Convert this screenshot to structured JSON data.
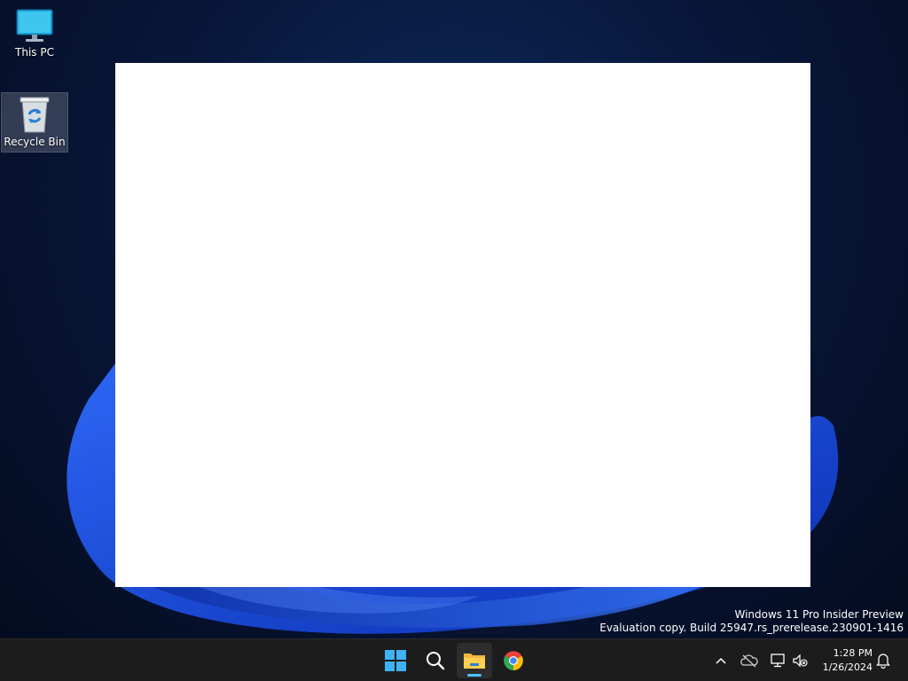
{
  "desktop": {
    "icons": [
      {
        "label": "This PC",
        "icon": "monitor-icon"
      },
      {
        "label": "Recycle Bin",
        "icon": "recycle-bin-icon"
      }
    ],
    "watermark": {
      "line1": "Windows 11 Pro Insider Preview",
      "line2": "Evaluation copy. Build 25947.rs_prerelease.230901-1416"
    }
  },
  "taskbar": {
    "apps": [
      {
        "name": "Start",
        "icon": "windows-logo-icon"
      },
      {
        "name": "Search",
        "icon": "search-icon"
      },
      {
        "name": "File Explorer",
        "icon": "folder-icon",
        "active": true
      },
      {
        "name": "Google Chrome",
        "icon": "chrome-icon"
      }
    ],
    "tray": {
      "icons": [
        "chevron-up-icon",
        "onedrive-offline-icon",
        "network-icon",
        "volume-muted-icon",
        "notification-bell-icon"
      ],
      "time": "1:28 PM",
      "date": "1/26/2024"
    }
  },
  "colors": {
    "taskbar_bg": "#1c1c1c",
    "desktop_bg": "#08173a",
    "accent": "#4cc2ff"
  }
}
